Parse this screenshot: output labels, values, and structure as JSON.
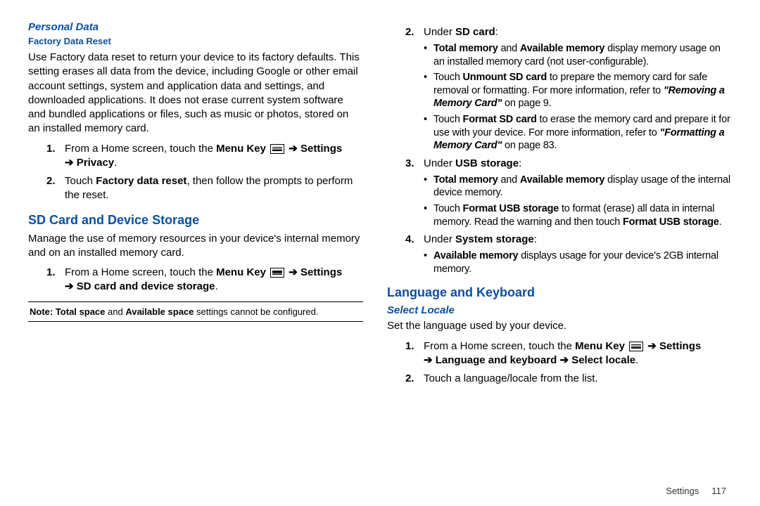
{
  "left": {
    "h_personal": "Personal Data",
    "h_factory": "Factory Data Reset",
    "factory_para": "Use Factory data reset to return your device to its factory defaults. This setting erases all data from the device, including Google or other email account settings, system and application data and settings, and downloaded applications. It does not erase current system software and bundled applications or files, such as music or photos, stored on an installed memory card.",
    "steps_factory": {
      "s1_pre": "From a Home screen, touch the ",
      "s1_menu": "Menu Key",
      "s1_post_settings": " Settings",
      "s1_line2_arrow": "➔",
      "s1_line2": " Privacy",
      "s1_period": ".",
      "s2_pre": "Touch ",
      "s2_bold": "Factory data reset",
      "s2_post": ", then follow the prompts to perform the reset."
    },
    "h_sd": "SD Card and Device Storage",
    "sd_para": "Manage the use of memory resources in your device's internal memory and on an installed memory card.",
    "steps_sd": {
      "s1_pre": "From a Home screen, touch the ",
      "s1_menu": "Menu Key",
      "s1_post_settings": " Settings",
      "s1_line2_arrow": "➔",
      "s1_line2": " SD card and device storage",
      "s1_period": "."
    },
    "note_pre": "Note: Total space",
    "note_mid": " and ",
    "note_bold2": "Available space",
    "note_post": " settings cannot be configured."
  },
  "right": {
    "s2_pre": "Under ",
    "s2_bold": "SD card",
    "s2_post": ":",
    "sd_bullets": {
      "b1_a": "Total memory",
      "b1_mid": " and ",
      "b1_b": "Available memory",
      "b1_post": " display memory usage on an installed memory card (not user-configurable).",
      "b2_pre": "Touch ",
      "b2_bold": "Unmount SD card",
      "b2_mid": " to prepare the memory card for safe removal or formatting. For more information, refer to ",
      "b2_ital": "\"Removing a Memory Card\"",
      "b2_post": " on page 9.",
      "b3_pre": "Touch ",
      "b3_bold": "Format SD card",
      "b3_mid": " to erase the memory card and prepare it for use with your device. For more information, refer to ",
      "b3_ital": "\"Formatting a Memory Card\"",
      "b3_post": " on page 83."
    },
    "s3_pre": "Under ",
    "s3_bold": "USB storage",
    "s3_post": ":",
    "usb_bullets": {
      "b1_a": "Total memory",
      "b1_mid": " and ",
      "b1_b": "Available memory",
      "b1_post": " display usage of the internal device memory.",
      "b2_pre": "Touch ",
      "b2_bold": "Format USB storage",
      "b2_mid": " to format (erase) all data in internal memory. Read the warning and then touch ",
      "b2_bold2": "Format USB storage",
      "b2_post": "."
    },
    "s4_pre": "Under ",
    "s4_bold": "System storage",
    "s4_post": ":",
    "sys_bullets": {
      "b1_a": "Available memory",
      "b1_post": " displays usage for your device's 2GB internal memory."
    },
    "h_lang": "Language and Keyboard",
    "h_locale": "Select Locale",
    "locale_para": "Set the language used by your device.",
    "steps_lang": {
      "s1_pre": "From a Home screen, touch the ",
      "s1_menu": "Menu Key",
      "s1_post_settings": " Settings",
      "s1_line2_arrow": "➔",
      "s1_line2a": " Language and keyboard ",
      "s1_line2_arrow2": "➔",
      "s1_line2b": " Select locale",
      "s1_period": ".",
      "s2": "Touch a language/locale from the list."
    }
  },
  "footer": {
    "section": "Settings",
    "page": "117"
  },
  "arrow": "➔"
}
